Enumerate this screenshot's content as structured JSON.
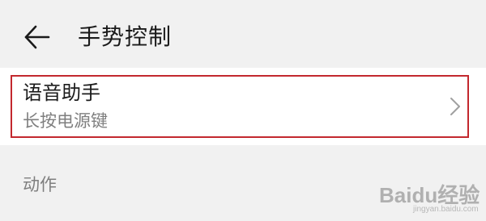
{
  "header": {
    "back_icon": "arrow-left-icon",
    "title": "手势控制"
  },
  "voice_assistant": {
    "title": "语音助手",
    "subtitle": "长按电源键",
    "chevron_icon": "chevron-right-icon",
    "highlight_color": "#c3282e"
  },
  "section": {
    "label": "动作"
  },
  "watermark": {
    "brand": "Baidu经验",
    "url": "jingyan.baidu.com"
  }
}
